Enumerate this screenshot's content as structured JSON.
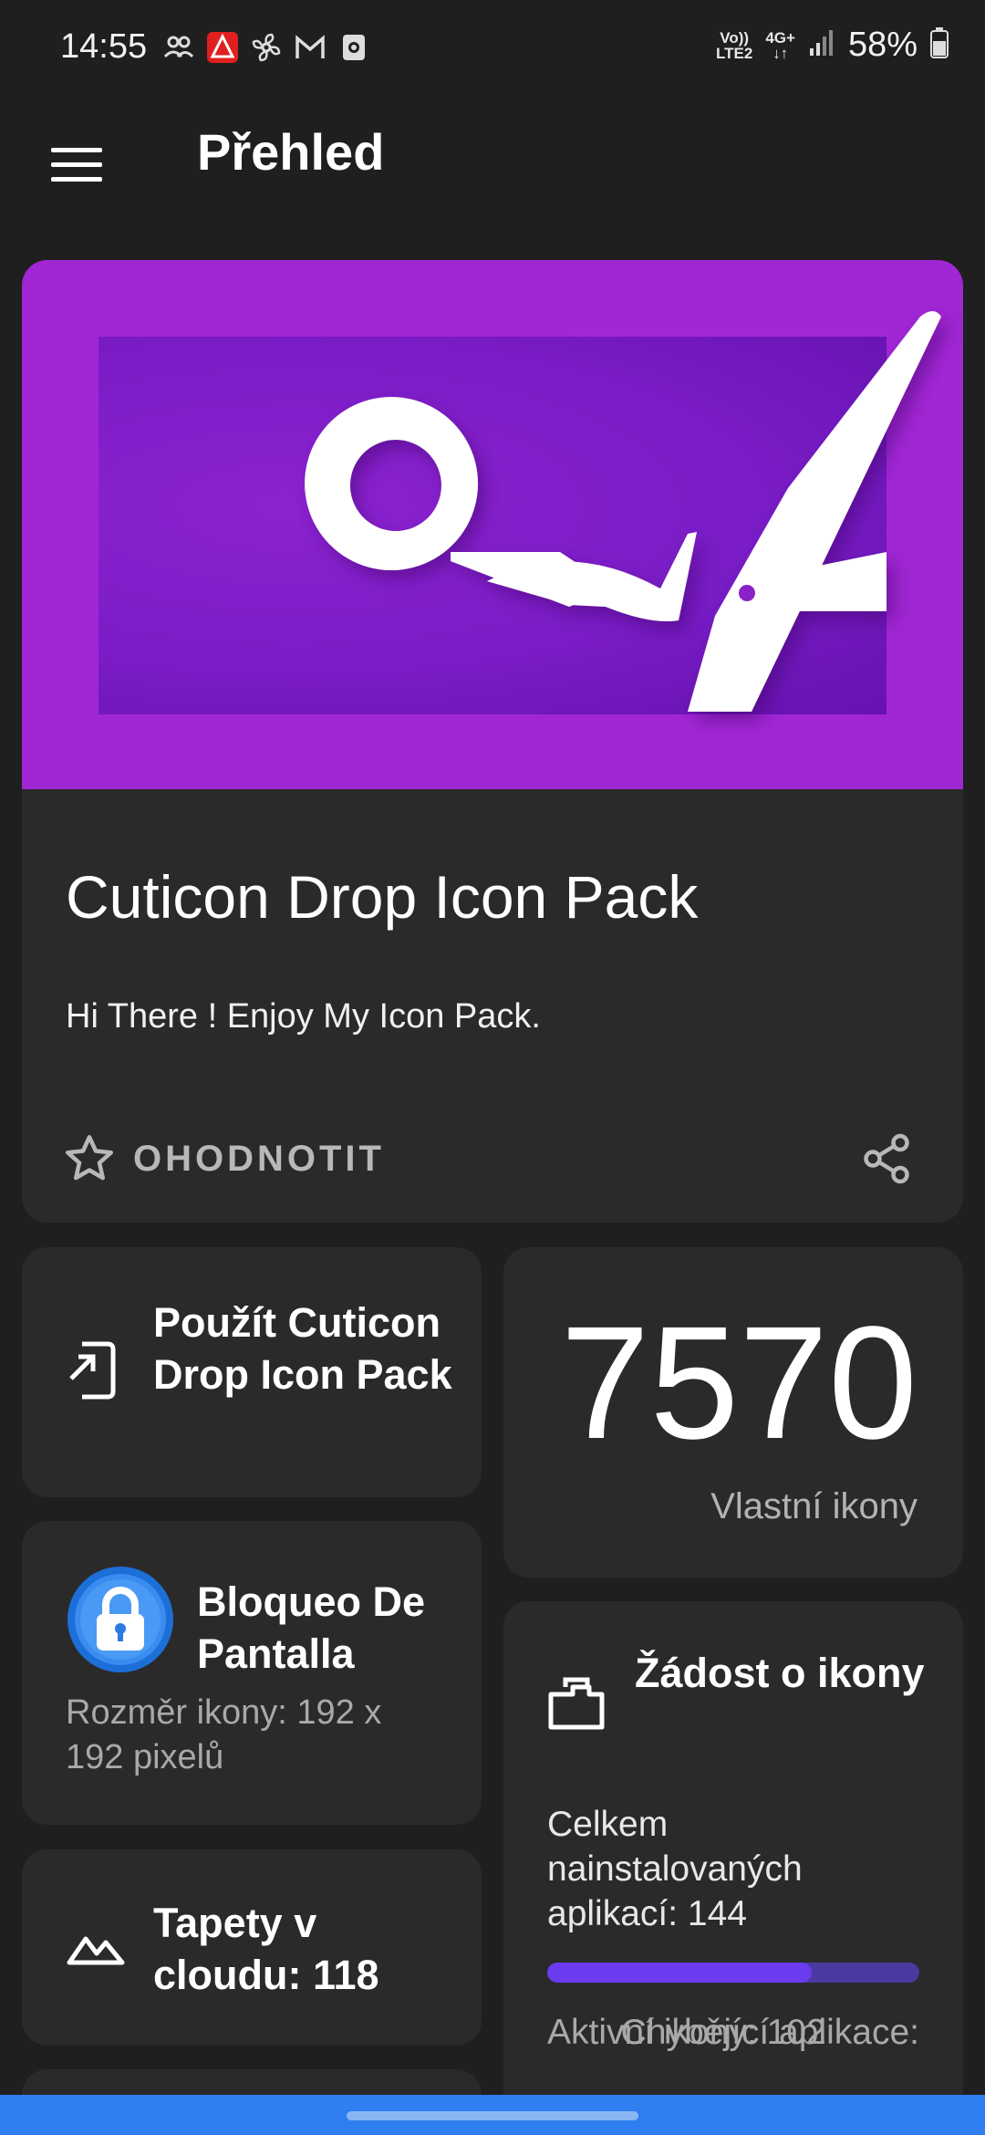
{
  "status_bar": {
    "time": "14:55",
    "icons": [
      "group-icon",
      "app-alert-icon",
      "fan-icon",
      "gmail-icon",
      "camera-icon"
    ],
    "network_top": "Vo))",
    "network_bottom": "LTE2",
    "data_type": "4G+",
    "battery_pct": "58%"
  },
  "app_bar": {
    "title": "Přehled"
  },
  "hero": {
    "title": "Cuticon Drop Icon Pack",
    "subtitle": "Hi There ! Enjoy My Icon Pack.",
    "rate_label": "OHODNOTIT",
    "banner_color": "#a126d4"
  },
  "apply": {
    "label": "Použít Cuticon Drop Icon Pack"
  },
  "icon_count": {
    "value": "7570",
    "label": "Vlastní ikony"
  },
  "lock": {
    "title": "Bloqueo De Pantalla",
    "subtitle": "Rozměr ikony: 192 x 192 pixelů"
  },
  "request": {
    "title": "Žádost o ikony",
    "total": "Celkem nainstalovaných aplikací: 144",
    "progress": 0.71,
    "active": "Aktivní ikony: 102",
    "missing": "Chybějící aplikace:"
  },
  "wallpapers": {
    "label": "Tapety v cloudu: 118"
  },
  "colors": {
    "accent": "#6b3bf0",
    "background": "#1f1f1f",
    "card": "#2a2a2b",
    "nav_bar": "#2f7ff0"
  }
}
